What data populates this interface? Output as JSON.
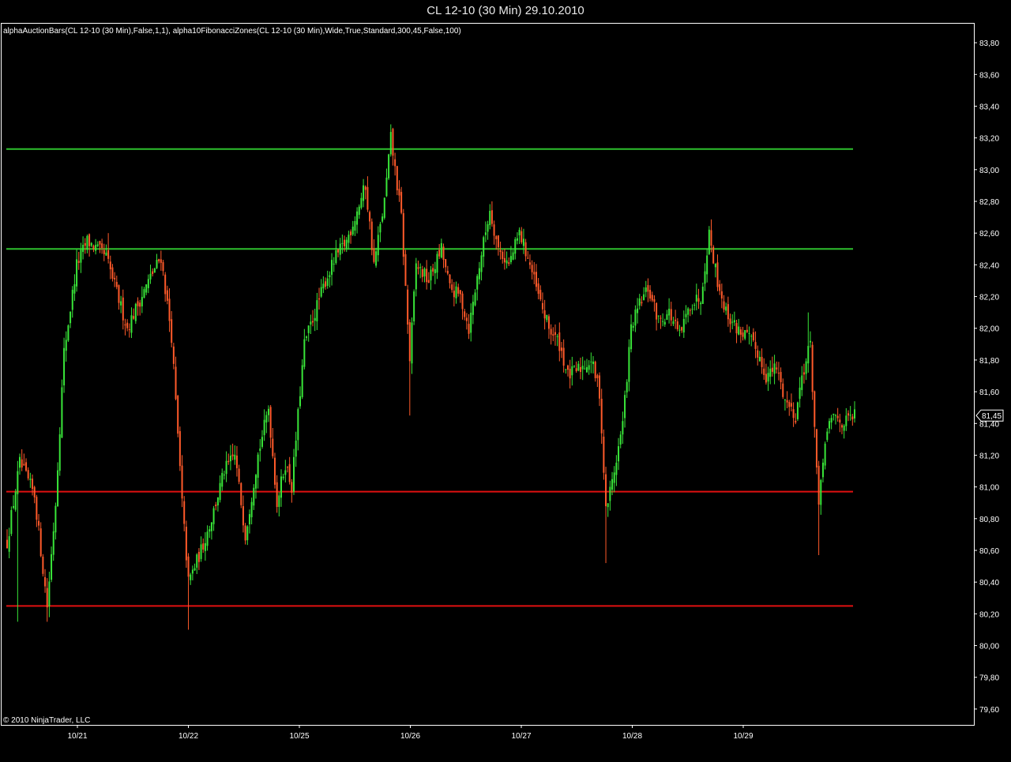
{
  "window": {
    "title": "CL 12-10 (30 Min)  29.10.2010",
    "indicator_label": "alphaAuctionBars(CL 12-10 (30 Min),False,1,1), alpha10FibonacciZones(CL 12-10 (30 Min),Wide,True,Standard,300,45,False,100)",
    "copyright": "© 2010 NinjaTrader, LLC",
    "last_price_label": "81,45"
  },
  "colors": {
    "background": "#000000",
    "bull": "#39e639",
    "bear": "#ff5a2a",
    "resistance": "#2ec02e",
    "support": "#e01010",
    "axis": "#ffffff"
  },
  "chart_data": {
    "type": "candlestick",
    "title": "CL 12-10 (30 Min)  29.10.2010",
    "x_tick_labels": [
      "10/21",
      "10/22",
      "10/25",
      "10/26",
      "10/27",
      "10/28",
      "10/29"
    ],
    "y_tick_labels": [
      "83,80",
      "83,60",
      "83,40",
      "83,20",
      "83,00",
      "82,80",
      "82,60",
      "82,40",
      "82,20",
      "82,00",
      "81,80",
      "81,60",
      "81,40",
      "81,20",
      "81,00",
      "80,80",
      "80,60",
      "80,40",
      "80,20",
      "80,00",
      "79,80",
      "79,60"
    ],
    "ylim": [
      79.5,
      83.92
    ],
    "grid": false,
    "last_price": 81.45,
    "horizontal_levels": [
      {
        "value": 83.13,
        "kind": "resistance"
      },
      {
        "value": 82.5,
        "kind": "resistance"
      },
      {
        "value": 80.97,
        "kind": "support"
      },
      {
        "value": 80.25,
        "kind": "support"
      }
    ],
    "close_path": [
      [
        0,
        80.65
      ],
      [
        6,
        81.15
      ],
      [
        13,
        80.95
      ],
      [
        19,
        80.25
      ],
      [
        23,
        80.9
      ],
      [
        27,
        81.85
      ],
      [
        33,
        82.4
      ],
      [
        38,
        82.55
      ],
      [
        47,
        82.45
      ],
      [
        57,
        82.0
      ],
      [
        62,
        82.15
      ],
      [
        69,
        82.35
      ],
      [
        73,
        82.45
      ],
      [
        78,
        81.95
      ],
      [
        83,
        80.9
      ],
      [
        86,
        80.4
      ],
      [
        92,
        80.6
      ],
      [
        97,
        80.8
      ],
      [
        103,
        81.1
      ],
      [
        108,
        81.2
      ],
      [
        113,
        80.7
      ],
      [
        119,
        81.2
      ],
      [
        124,
        81.5
      ],
      [
        128,
        80.9
      ],
      [
        132,
        81.15
      ],
      [
        135,
        81.0
      ],
      [
        141,
        81.9
      ],
      [
        146,
        82.1
      ],
      [
        151,
        82.3
      ],
      [
        156,
        82.45
      ],
      [
        161,
        82.55
      ],
      [
        165,
        82.7
      ],
      [
        170,
        82.9
      ],
      [
        174,
        82.4
      ],
      [
        179,
        82.8
      ],
      [
        182,
        83.2
      ],
      [
        187,
        82.7
      ],
      [
        191,
        81.8
      ],
      [
        194,
        82.4
      ],
      [
        200,
        82.3
      ],
      [
        206,
        82.5
      ],
      [
        210,
        82.25
      ],
      [
        215,
        82.2
      ],
      [
        219,
        82.0
      ],
      [
        224,
        82.4
      ],
      [
        229,
        82.75
      ],
      [
        233,
        82.5
      ],
      [
        238,
        82.4
      ],
      [
        243,
        82.6
      ],
      [
        247,
        82.45
      ],
      [
        252,
        82.2
      ],
      [
        257,
        82.0
      ],
      [
        262,
        81.9
      ],
      [
        266,
        81.7
      ],
      [
        272,
        81.75
      ],
      [
        277,
        81.8
      ],
      [
        281,
        81.6
      ],
      [
        284,
        80.85
      ],
      [
        288,
        81.1
      ],
      [
        292,
        81.4
      ],
      [
        296,
        82.0
      ],
      [
        300,
        82.15
      ],
      [
        304,
        82.25
      ],
      [
        309,
        82.05
      ],
      [
        314,
        82.1
      ],
      [
        319,
        81.95
      ],
      [
        324,
        82.15
      ],
      [
        329,
        82.2
      ],
      [
        333,
        82.6
      ],
      [
        337,
        82.3
      ],
      [
        341,
        82.1
      ],
      [
        346,
        82.0
      ],
      [
        351,
        81.95
      ],
      [
        356,
        81.85
      ],
      [
        360,
        81.7
      ],
      [
        365,
        81.75
      ],
      [
        369,
        81.55
      ],
      [
        374,
        81.45
      ],
      [
        377,
        81.7
      ],
      [
        381,
        81.9
      ],
      [
        385,
        80.85
      ],
      [
        388,
        81.3
      ],
      [
        392,
        81.45
      ],
      [
        397,
        81.4
      ],
      [
        402,
        81.45
      ]
    ],
    "spikes": [
      {
        "i": 5,
        "value": 80.15
      },
      {
        "i": 19,
        "value": 80.15
      },
      {
        "i": 48,
        "value": 82.6
      },
      {
        "i": 86,
        "value": 80.1
      },
      {
        "i": 182,
        "value": 83.28
      },
      {
        "i": 191,
        "value": 81.45
      },
      {
        "i": 284,
        "value": 80.52
      },
      {
        "i": 334,
        "value": 82.65
      },
      {
        "i": 385,
        "value": 80.57
      },
      {
        "i": 380,
        "value": 82.1
      }
    ]
  }
}
